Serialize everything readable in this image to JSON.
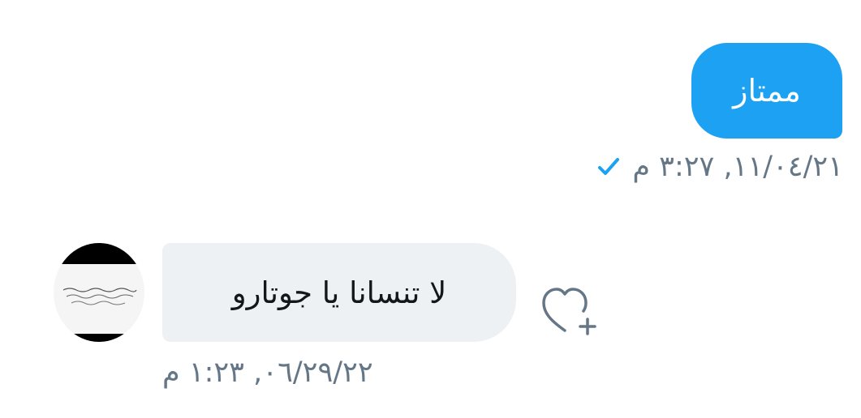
{
  "conversation": {
    "outgoing": {
      "text": "ممتاز",
      "timestamp": "١١/٠٤/٢١, ٣:٢٧ م",
      "status": "sent-check-icon"
    },
    "incoming": {
      "text": "لا تنسانا يا جوتارو",
      "timestamp": "٠٦/٢٩/٢٢, ١:٢٣ م"
    }
  },
  "colors": {
    "outgoing_bubble": "#1da1f2",
    "incoming_bubble": "#eef1f4",
    "timestamp": "#657786",
    "check": "#1da1f2",
    "heart_icon": "#657786"
  }
}
